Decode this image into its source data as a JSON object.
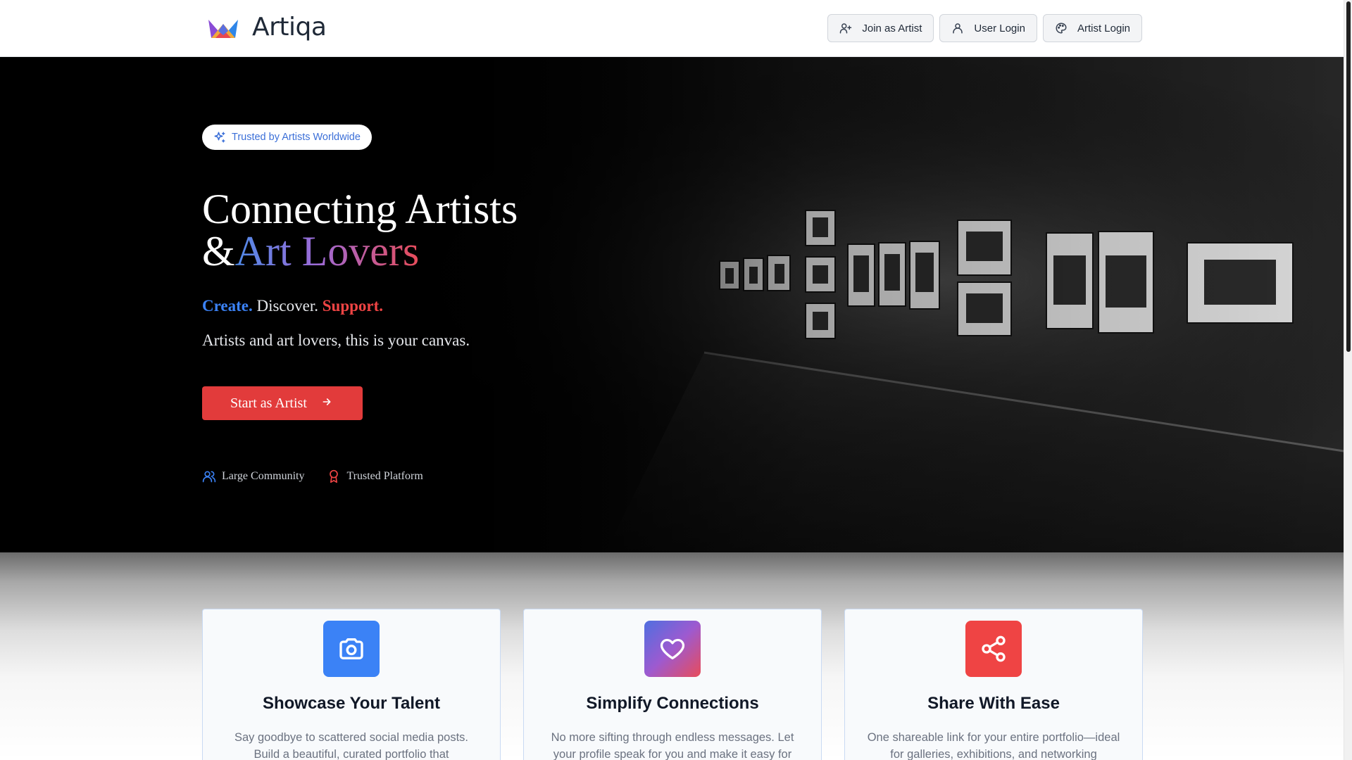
{
  "header": {
    "brand": "Artiqa",
    "nav": [
      {
        "label": "Join as Artist",
        "icon": "user-plus-icon"
      },
      {
        "label": "User Login",
        "icon": "user-icon"
      },
      {
        "label": "Artist Login",
        "icon": "palette-icon"
      }
    ]
  },
  "hero": {
    "badge": "Trusted by Artists Worldwide",
    "title_line1": "Connecting Artists",
    "title_prefix": "&",
    "title_gradient": "Art Lovers",
    "tagline": {
      "create": "Create.",
      "discover": "Discover.",
      "support": "Support."
    },
    "subtitle": "Artists and art lovers, this is your canvas.",
    "cta_label": "Start as Artist",
    "stats": [
      {
        "label": "Large Community",
        "icon": "users-icon"
      },
      {
        "label": "Trusted Platform",
        "icon": "award-icon"
      }
    ]
  },
  "features": [
    {
      "title": "Showcase Your Talent",
      "text": "Say goodbye to scattered social media posts. Build a beautiful, curated portfolio that",
      "icon": "camera-icon"
    },
    {
      "title": "Simplify Connections",
      "text": "No more sifting through endless messages. Let your profile speak for you and make it easy for",
      "icon": "heart-icon"
    },
    {
      "title": "Share With Ease",
      "text": "One shareable link for your entire portfolio—ideal for galleries, exhibitions, and networking",
      "icon": "share-icon"
    }
  ],
  "colors": {
    "accent_blue": "#3b82f6",
    "accent_red": "#ef4444",
    "cta": "#e23b3b"
  }
}
